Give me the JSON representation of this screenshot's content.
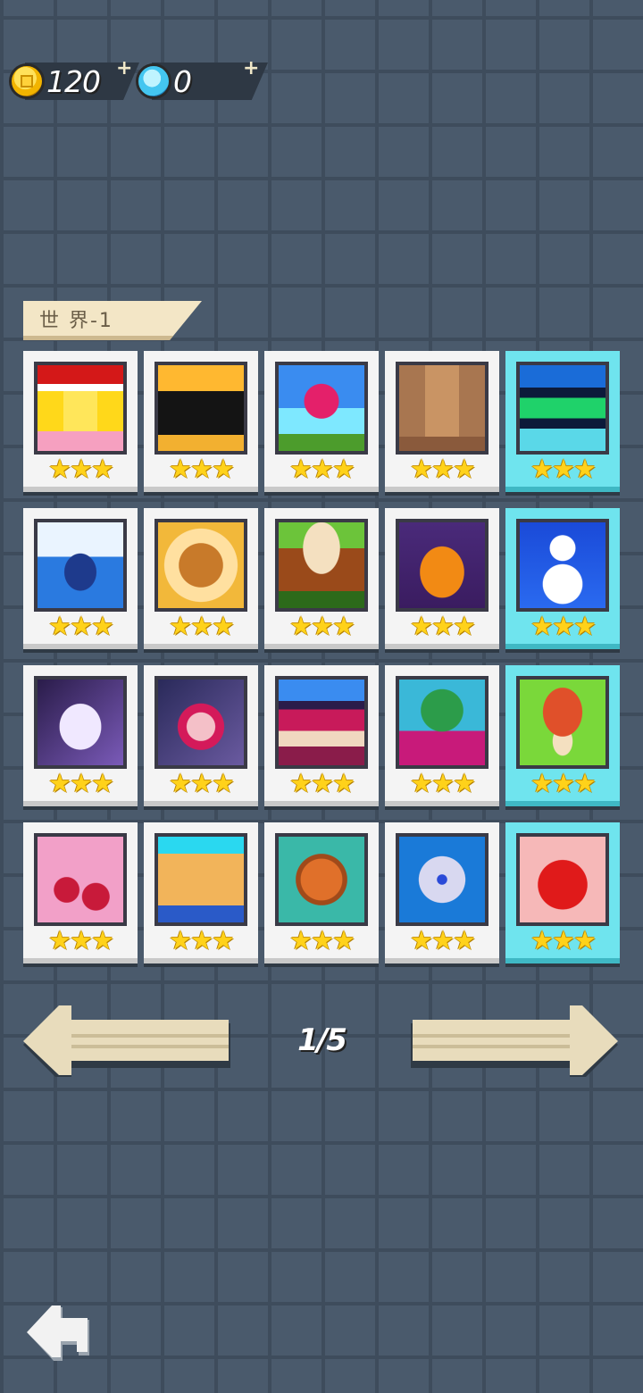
{
  "currency": {
    "coins": "120",
    "gems": "0",
    "plus_symbol": "+"
  },
  "world": {
    "title": "世 界-1"
  },
  "levels": [
    {
      "id": "level-1",
      "icon": "chick-icon",
      "stars": 3,
      "rating": "★★★",
      "special": false
    },
    {
      "id": "level-2",
      "icon": "black-cat-icon",
      "stars": 3,
      "rating": "★★★",
      "special": false
    },
    {
      "id": "level-3",
      "icon": "rose-icon",
      "stars": 3,
      "rating": "★★★",
      "special": false
    },
    {
      "id": "level-4",
      "icon": "wooden-door-icon",
      "stars": 3,
      "rating": "★★★",
      "special": false
    },
    {
      "id": "level-5",
      "icon": "green-bottle-icon",
      "stars": 3,
      "rating": "★★★",
      "special": true
    },
    {
      "id": "level-6",
      "icon": "penguin-icon",
      "stars": 3,
      "rating": "★★★",
      "special": false
    },
    {
      "id": "level-7",
      "icon": "cookie-icon",
      "stars": 3,
      "rating": "★★★",
      "special": false
    },
    {
      "id": "level-8",
      "icon": "drum-icon",
      "stars": 3,
      "rating": "★★★",
      "special": false
    },
    {
      "id": "level-9",
      "icon": "pumpkin-icon",
      "stars": 3,
      "rating": "★★★",
      "special": false
    },
    {
      "id": "level-10",
      "icon": "snowman-icon",
      "stars": 3,
      "rating": "★★★",
      "special": true
    },
    {
      "id": "level-11",
      "icon": "ghost-icon",
      "stars": 3,
      "rating": "★★★",
      "special": false
    },
    {
      "id": "level-12",
      "icon": "vampire-icon",
      "stars": 3,
      "rating": "★★★",
      "special": false
    },
    {
      "id": "level-13",
      "icon": "book-stack-icon",
      "stars": 3,
      "rating": "★★★",
      "special": false
    },
    {
      "id": "level-14",
      "icon": "potted-cactus-icon",
      "stars": 3,
      "rating": "★★★",
      "special": false
    },
    {
      "id": "level-15",
      "icon": "mushroom-icon",
      "stars": 3,
      "rating": "★★★",
      "special": true
    },
    {
      "id": "level-16",
      "icon": "cherries-icon",
      "stars": 3,
      "rating": "★★★",
      "special": false
    },
    {
      "id": "level-17",
      "icon": "folder-icon",
      "stars": 3,
      "rating": "★★★",
      "special": false
    },
    {
      "id": "level-18",
      "icon": "copper-coin-icon",
      "stars": 3,
      "rating": "★★★",
      "special": false
    },
    {
      "id": "level-19",
      "icon": "disc-icon",
      "stars": 3,
      "rating": "★★★",
      "special": false
    },
    {
      "id": "level-20",
      "icon": "tomato-icon",
      "stars": 3,
      "rating": "★★★",
      "special": true
    }
  ],
  "pager": {
    "indicator": "1/5",
    "current": 1,
    "total": 5
  },
  "colors": {
    "background": "#4a5a6c",
    "card": "#f4f4f4",
    "special_card": "#6fe4ee",
    "star": "#ffd21a",
    "label_bg": "#f3e6c6",
    "arrow": "#e8dcbc"
  }
}
